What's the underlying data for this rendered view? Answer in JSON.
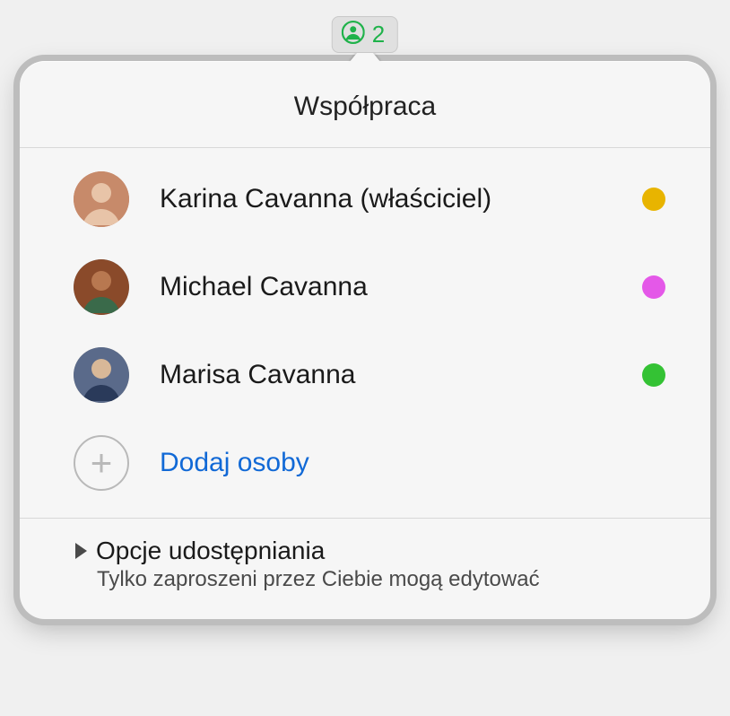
{
  "badge": {
    "count": "2",
    "icon_color": "#1fb24a"
  },
  "popover": {
    "title": "Współpraca",
    "participants": [
      {
        "name": "Karina Cavanna (właściciel)",
        "dot_color": "#e8b400",
        "avatar_bg": "#c27a5a"
      },
      {
        "name": "Michael Cavanna",
        "dot_color": "#e458e8",
        "avatar_bg": "#6b3820"
      },
      {
        "name": "Marisa Cavanna",
        "dot_color": "#34c234",
        "avatar_bg": "#4a5a7a"
      }
    ],
    "add_label": "Dodaj osoby",
    "footer": {
      "title": "Opcje udostępniania",
      "subtitle": "Tylko zaproszeni przez Ciebie mogą edytować"
    }
  }
}
